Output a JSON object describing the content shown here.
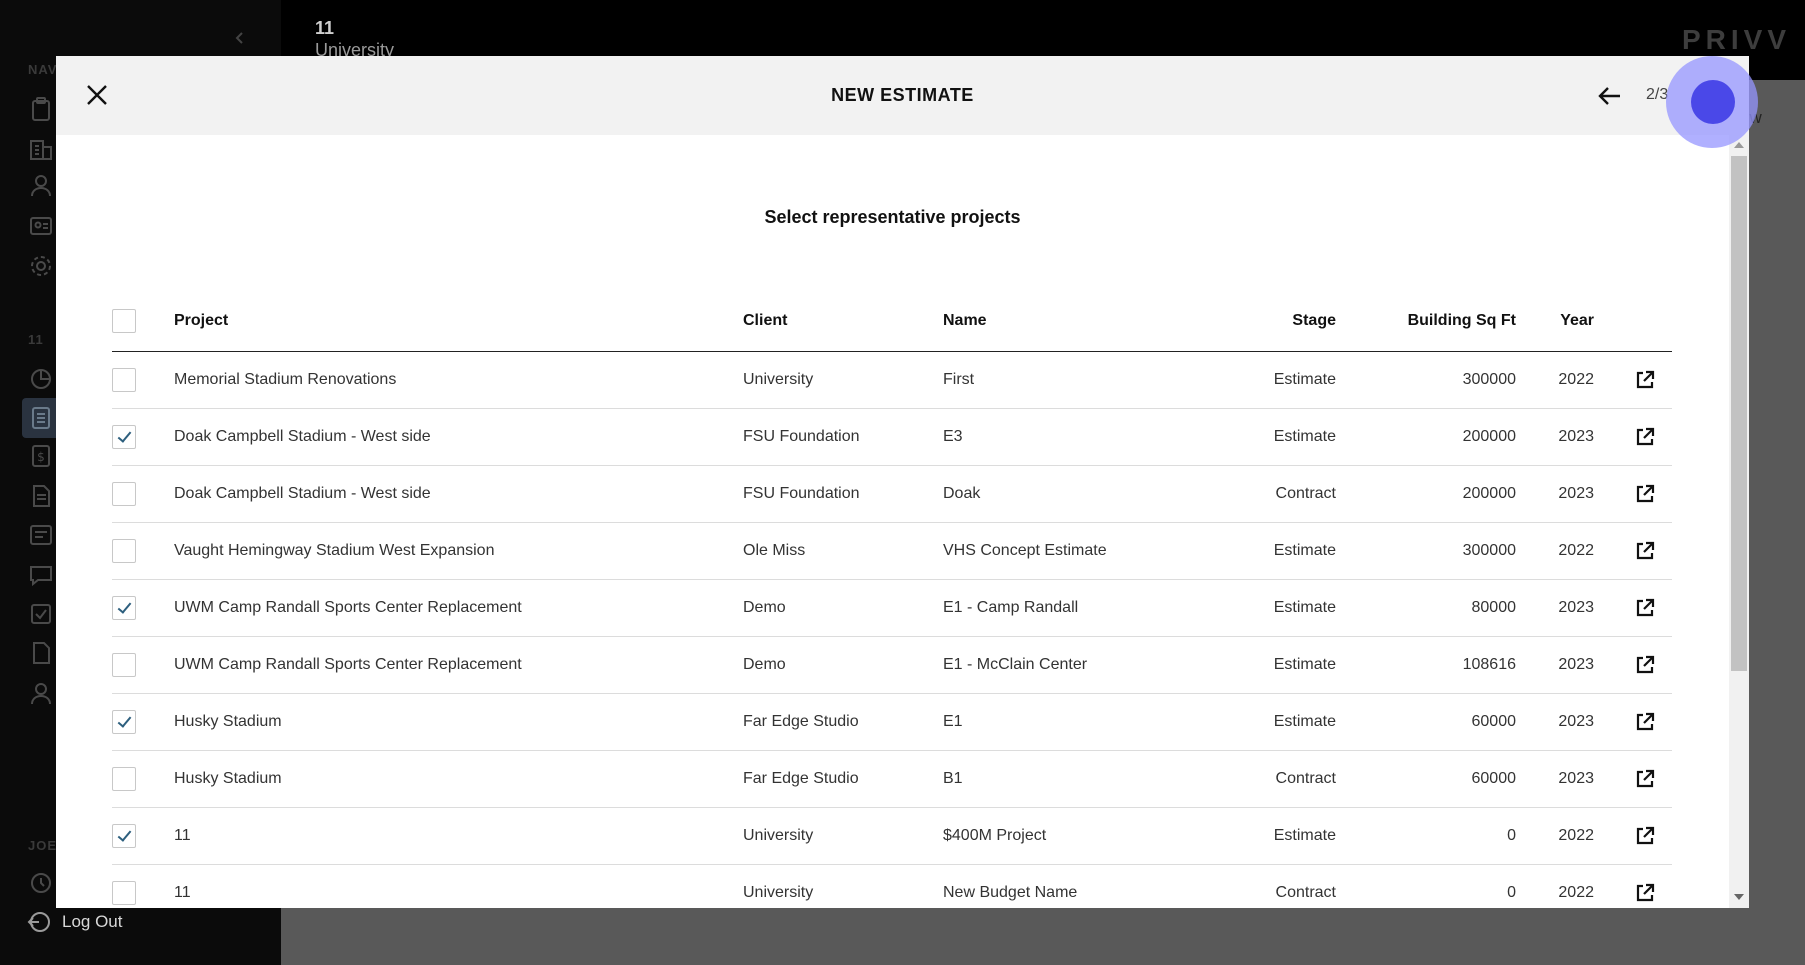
{
  "app": {
    "brand": "PRIVV",
    "topbar_number": "11",
    "topbar_subtitle": "University",
    "behind_modal_text": "ew",
    "logout_label": "Log Out",
    "sidebar_section_labels": [
      "NAV",
      "11",
      "JOE"
    ]
  },
  "modal": {
    "title": "NEW ESTIMATE",
    "step": "2/3",
    "section_title": "Select representative projects",
    "columns": {
      "project": "Project",
      "client": "Client",
      "name": "Name",
      "stage": "Stage",
      "sqft": "Building Sq Ft",
      "year": "Year"
    },
    "rows": [
      {
        "checked": false,
        "project": "Memorial Stadium Renovations",
        "client": "University",
        "name": "First",
        "stage": "Estimate",
        "sqft": "300000",
        "year": "2022"
      },
      {
        "checked": true,
        "project": "Doak Campbell Stadium - West side",
        "client": "FSU Foundation",
        "name": "E3",
        "stage": "Estimate",
        "sqft": "200000",
        "year": "2023"
      },
      {
        "checked": false,
        "project": "Doak Campbell Stadium - West side",
        "client": "FSU Foundation",
        "name": "Doak",
        "stage": "Contract",
        "sqft": "200000",
        "year": "2023"
      },
      {
        "checked": false,
        "project": "Vaught Hemingway Stadium West Expansion",
        "client": "Ole Miss",
        "name": "VHS Concept Estimate",
        "stage": "Estimate",
        "sqft": "300000",
        "year": "2022"
      },
      {
        "checked": true,
        "project": "UWM Camp Randall Sports Center Replacement",
        "client": "Demo",
        "name": "E1 - Camp Randall",
        "stage": "Estimate",
        "sqft": "80000",
        "year": "2023"
      },
      {
        "checked": false,
        "project": "UWM Camp Randall Sports Center Replacement",
        "client": "Demo",
        "name": "E1 - McClain Center",
        "stage": "Estimate",
        "sqft": "108616",
        "year": "2023"
      },
      {
        "checked": true,
        "project": "Husky Stadium",
        "client": "Far Edge Studio",
        "name": "E1",
        "stage": "Estimate",
        "sqft": "60000",
        "year": "2023"
      },
      {
        "checked": false,
        "project": "Husky Stadium",
        "client": "Far Edge Studio",
        "name": "B1",
        "stage": "Contract",
        "sqft": "60000",
        "year": "2023"
      },
      {
        "checked": true,
        "project": "11",
        "client": "University",
        "name": "$400M Project",
        "stage": "Estimate",
        "sqft": "0",
        "year": "2022"
      },
      {
        "checked": false,
        "project": "11",
        "client": "University",
        "name": "New Budget Name",
        "stage": "Contract",
        "sqft": "0",
        "year": "2022"
      }
    ]
  },
  "colors": {
    "checkmark": "#2d5f7e",
    "cursor": "#4a48e8",
    "header_bg": "#f2f2f2"
  }
}
